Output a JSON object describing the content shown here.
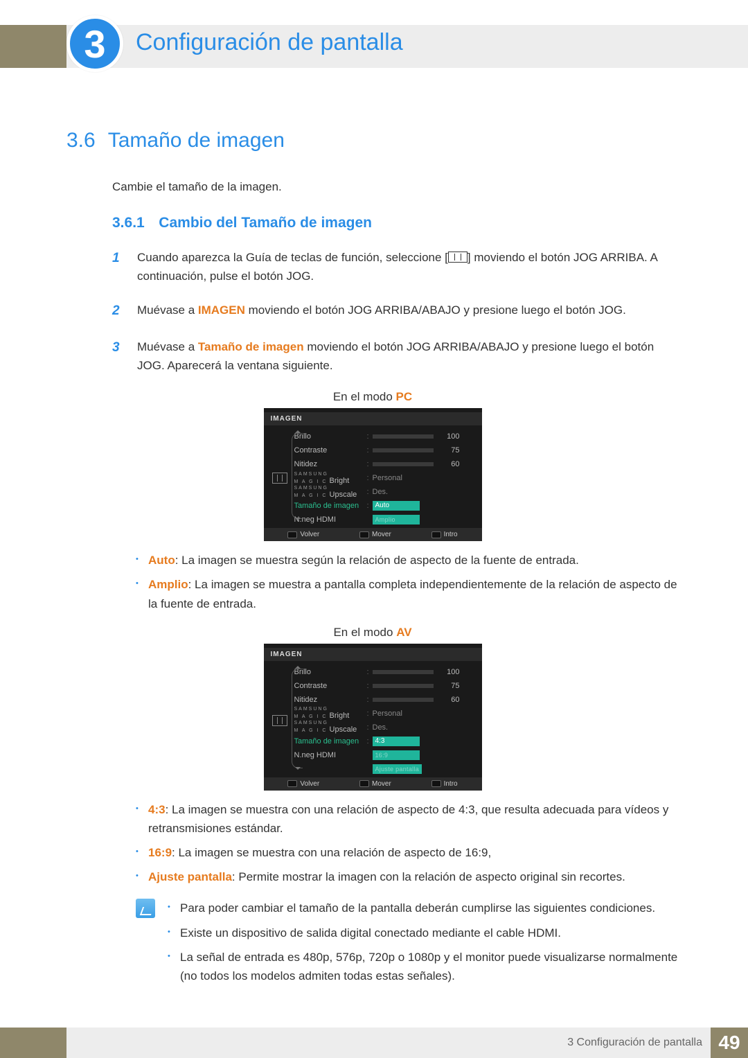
{
  "chapter": {
    "number": "3",
    "title": "Configuración de pantalla"
  },
  "section": {
    "number": "3.6",
    "title": "Tamaño de imagen"
  },
  "intro": "Cambie el tamaño de la imagen.",
  "subsection": {
    "number": "3.6.1",
    "title": "Cambio del Tamaño de imagen"
  },
  "steps": {
    "1": {
      "pre": "Cuando aparezca la Guía de teclas de función, seleccione [",
      "post": "] moviendo el botón JOG ARRIBA. A continuación, pulse el botón JOG."
    },
    "2": {
      "a": "Muévase a ",
      "bold": "IMAGEN",
      "b": " moviendo el botón JOG ARRIBA/ABAJO y presione luego el botón JOG."
    },
    "3": {
      "a": "Muévase a ",
      "bold": "Tamaño de imagen",
      "b": " moviendo el botón JOG ARRIBA/ABAJO y presione luego el botón JOG. Aparecerá la ventana siguiente."
    }
  },
  "mode_pc": {
    "prefix": "En el modo ",
    "mode": "PC"
  },
  "mode_av": {
    "prefix": "En el modo ",
    "mode": "AV"
  },
  "osd": {
    "title": "IMAGEN",
    "rows": {
      "brillo": {
        "label": "Brillo",
        "val": "100"
      },
      "contraste": {
        "label": "Contraste",
        "val": "75"
      },
      "nitidez": {
        "label": "Nitidez",
        "val": "60"
      },
      "bright": {
        "brand": "SAMSUNG",
        "magic": "M A G I C",
        "suffix": "Bright",
        "val": "Personal"
      },
      "upscale": {
        "brand": "SAMSUNG",
        "magic": "M A G I C",
        "suffix": "Upscale",
        "val": "Des."
      },
      "tamano": {
        "label": "Tamaño de imagen"
      },
      "nneg": {
        "label": "N.neg HDMI"
      }
    },
    "pc_opts": {
      "auto": "Auto",
      "amplio": "Amplio"
    },
    "av_opts": {
      "r43": "4:3",
      "r169": "16:9",
      "ajuste": "Ajuste pantalla"
    },
    "foot": {
      "volver": "Volver",
      "mover": "Mover",
      "intro": "Intro"
    }
  },
  "pc_bullets": {
    "auto": {
      "term": "Auto",
      "text": ": La imagen se muestra según la relación de aspecto de la fuente de entrada."
    },
    "amplio": {
      "term": "Amplio",
      "text": ": La imagen se muestra a pantalla completa independientemente de la relación de aspecto de la fuente de entrada."
    }
  },
  "av_bullets": {
    "r43": {
      "term": "4:3",
      "text": ": La imagen se muestra con una relación de aspecto de 4:3, que resulta adecuada para vídeos y retransmisiones estándar."
    },
    "r169": {
      "term": "16:9",
      "text": ": La imagen se muestra con una relación de aspecto de 16:9,"
    },
    "ajuste": {
      "term": "Ajuste pantalla",
      "text": ": Permite mostrar la imagen con la relación de aspecto original sin recortes."
    }
  },
  "notes": {
    "n1": "Para poder cambiar el tamaño de la pantalla deberán cumplirse las siguientes condiciones.",
    "n2": "Existe un dispositivo de salida digital conectado mediante el cable HDMI.",
    "n3": "La señal de entrada es 480p, 576p, 720p o 1080p y el monitor puede visualizarse normalmente (no todos los modelos admiten todas estas señales)."
  },
  "footer": {
    "label": "3 Configuración de pantalla",
    "page": "49"
  },
  "chart_data": {
    "type": "table",
    "title": "OSD IMAGEN settings",
    "rows": [
      {
        "label": "Brillo",
        "value": 100,
        "max": 100
      },
      {
        "label": "Contraste",
        "value": 75,
        "max": 100
      },
      {
        "label": "Nitidez",
        "value": 60,
        "max": 100
      },
      {
        "label": "SAMSUNG MAGIC Bright",
        "value": "Personal"
      },
      {
        "label": "SAMSUNG MAGIC Upscale",
        "value": "Des."
      },
      {
        "label": "Tamaño de imagen (PC)",
        "options": [
          "Auto",
          "Amplio"
        ],
        "selected": "Auto"
      },
      {
        "label": "Tamaño de imagen (AV)",
        "options": [
          "4:3",
          "16:9",
          "Ajuste pantalla"
        ],
        "selected": "4:3"
      },
      {
        "label": "N.neg HDMI",
        "value": ""
      }
    ]
  }
}
